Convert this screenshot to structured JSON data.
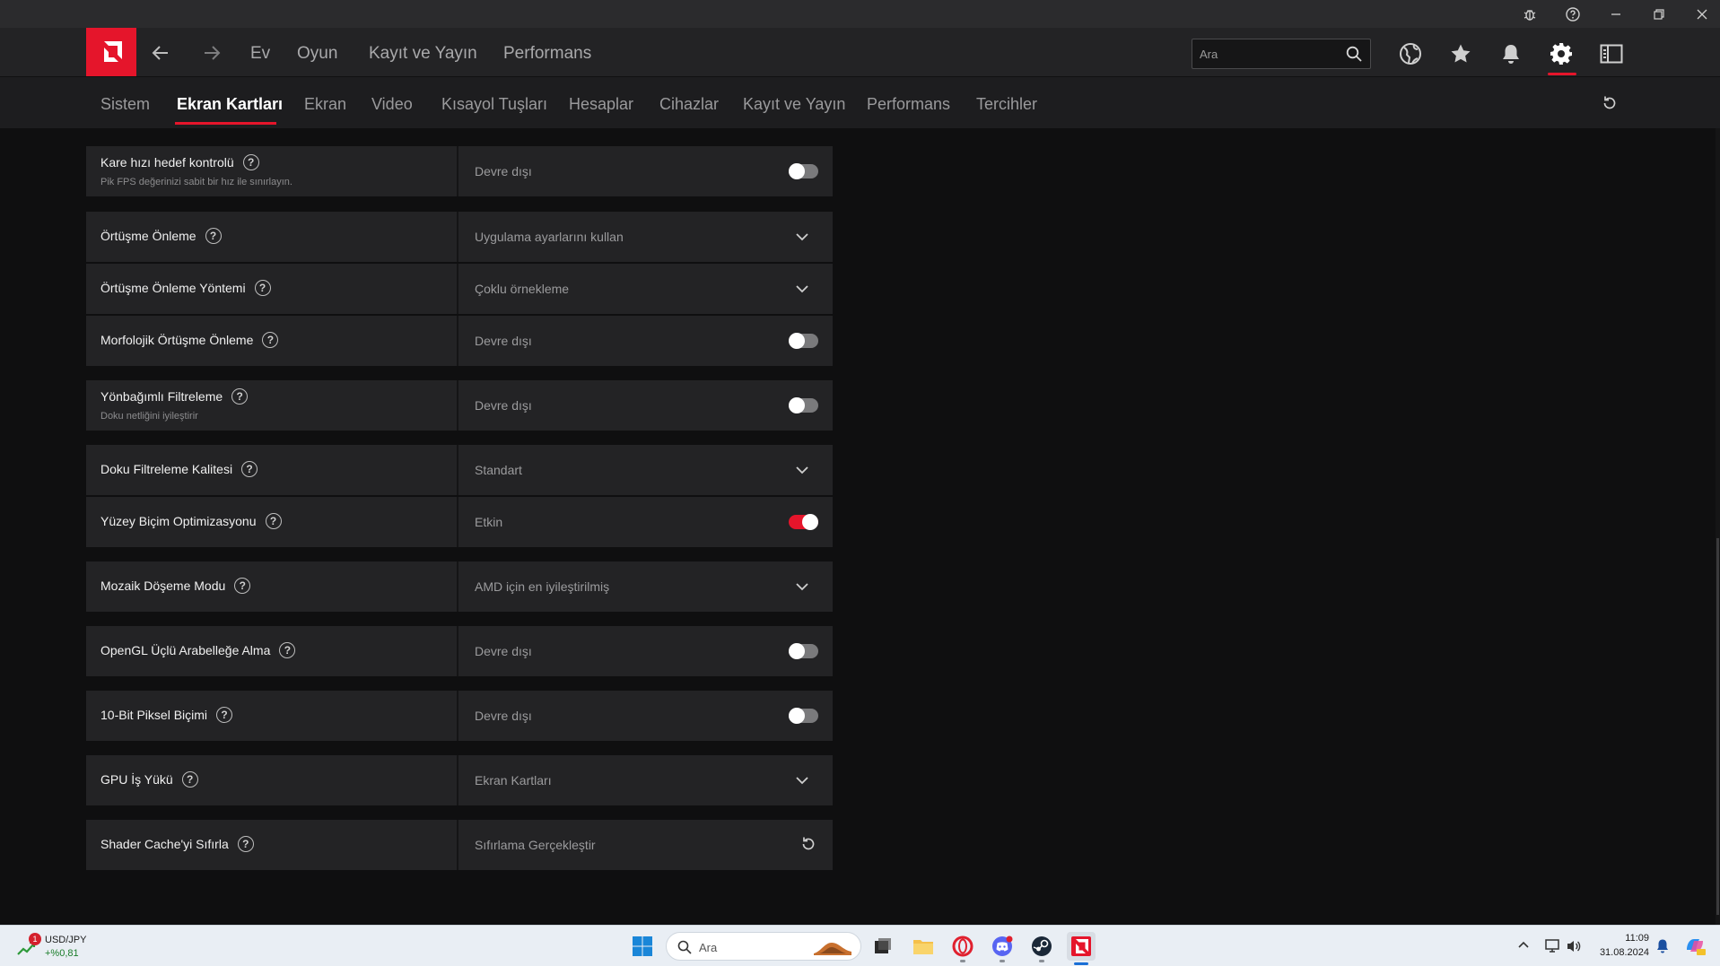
{
  "window": {
    "controls": [
      "bug-icon",
      "help-icon",
      "minimize-icon",
      "restore-icon",
      "close-icon"
    ]
  },
  "mainnav": {
    "links": [
      "Ev",
      "Oyun",
      "Kayıt ve Yayın",
      "Performans"
    ],
    "search_placeholder": "Ara",
    "icons": [
      "globe-icon",
      "star-icon",
      "bell-icon",
      "gear-icon",
      "sidebar-toggle-icon"
    ],
    "active_icon": "gear-icon"
  },
  "subnav": {
    "tabs": [
      "Sistem",
      "Ekran Kartları",
      "Ekran",
      "Video",
      "Kısayol Tuşları",
      "Hesaplar",
      "Cihazlar",
      "Kayıt ve Yayın",
      "Performans",
      "Tercihler"
    ],
    "active": "Ekran Kartları"
  },
  "settings": [
    {
      "label": "Kare hızı hedef kontrolü",
      "sub": "Pik FPS değerinizi sabit bir hız ile sınırlayın.",
      "value": "Devre dışı",
      "control": "toggle",
      "on": false
    },
    {
      "label": "Örtüşme Önleme",
      "sub": "",
      "value": "Uygulama ayarlarını kullan",
      "control": "dropdown"
    },
    {
      "label": "Örtüşme Önleme Yöntemi",
      "sub": "",
      "value": "Çoklu örnekleme",
      "control": "dropdown"
    },
    {
      "label": "Morfolojik Örtüşme Önleme",
      "sub": "",
      "value": "Devre dışı",
      "control": "toggle",
      "on": false
    },
    {
      "label": "Yönbağımlı Filtreleme",
      "sub": "Doku netliğini iyileştirir",
      "value": "Devre dışı",
      "control": "toggle",
      "on": false
    },
    {
      "label": "Doku Filtreleme Kalitesi",
      "sub": "",
      "value": "Standart",
      "control": "dropdown"
    },
    {
      "label": "Yüzey Biçim Optimizasyonu",
      "sub": "",
      "value": "Etkin",
      "control": "toggle",
      "on": true
    },
    {
      "label": "Mozaik Döşeme Modu",
      "sub": "",
      "value": "AMD için en iyileştirilmiş",
      "control": "dropdown"
    },
    {
      "label": "OpenGL Üçlü Arabelleğe Alma",
      "sub": "",
      "value": "Devre dışı",
      "control": "toggle",
      "on": false
    },
    {
      "label": "10-Bit Piksel Biçimi",
      "sub": "",
      "value": "Devre dışı",
      "control": "toggle",
      "on": false
    },
    {
      "label": "GPU İş Yükü",
      "sub": "",
      "value": "Ekran Kartları",
      "control": "dropdown"
    },
    {
      "label": "Shader Cache'yi Sıfırla",
      "sub": "",
      "value": "Sıfırlama Gerçekleştir",
      "control": "reset"
    }
  ],
  "help_glyph": "?",
  "colors": {
    "accent": "#e5152b",
    "panel": "#232325",
    "background": "#0f0f10"
  },
  "taskbar": {
    "widget": {
      "badge": "1",
      "ticker": "USD/JPY",
      "change": "+%0,81"
    },
    "search_placeholder": "Ara",
    "pinned": [
      "windows-start-icon",
      "file-explorer-icon",
      "folder-icon",
      "opera-icon",
      "discord-icon",
      "steam-icon",
      "amd-software-icon"
    ],
    "clock": {
      "time": "11:09",
      "date": "31.08.2024"
    }
  }
}
